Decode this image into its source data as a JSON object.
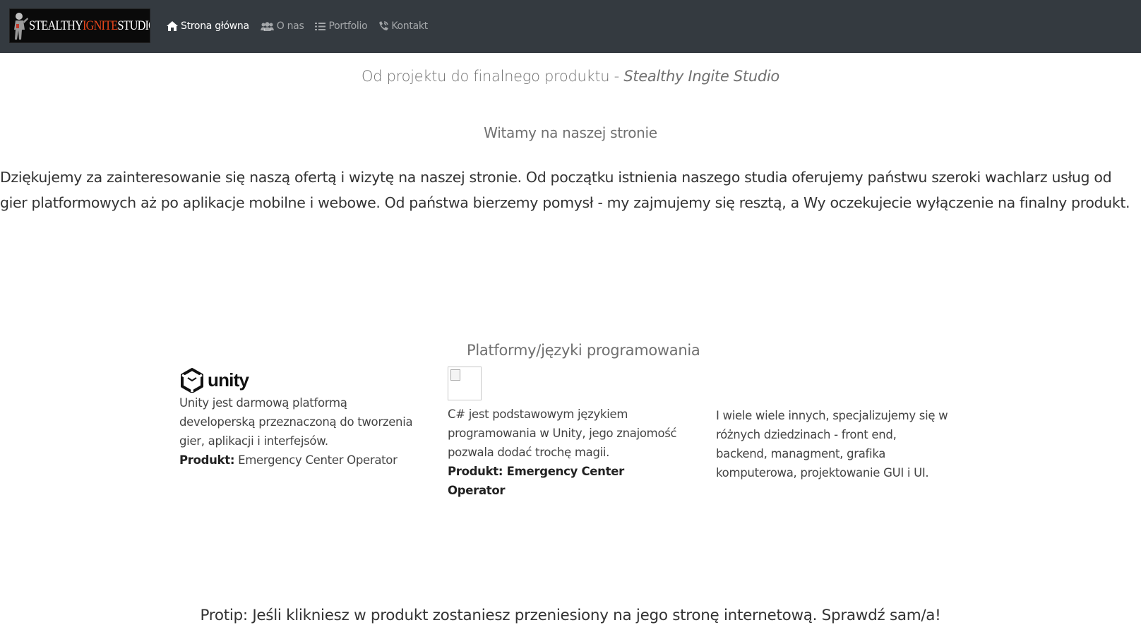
{
  "brand": {
    "logo_part1": "STEALTHY",
    "logo_part2": "IGNITE",
    "logo_part3": "STUDIO",
    "colors": {
      "navbar": "#343a40",
      "ignite_accent": "#e8461b"
    }
  },
  "nav": {
    "items": [
      {
        "label": "Strona główna",
        "icon": "home-icon",
        "active": true
      },
      {
        "label": "O nas",
        "icon": "users-icon",
        "active": false
      },
      {
        "label": "Portfolio",
        "icon": "list-icon",
        "active": false
      },
      {
        "label": "Kontakt",
        "icon": "phone-icon",
        "active": false
      }
    ]
  },
  "hero": {
    "tagline_prefix": "Od projektu do finalnego produktu - ",
    "tagline_brand": "Stealthy Ingite Studio",
    "welcome": "Witamy na naszej stronie",
    "intro": "Dziękujemy za zainteresowanie się naszą ofertą i wizytę na naszej stronie. Od początku istnienia naszego studia oferujemy państwu szeroki wachlarz usług od gier platformowych aż po aplikacje mobilne i webowe. Od państwa bierzemy pomysł - my zajmujemy się resztą, a Wy oczekujecie wyłączenie na finalny produkt."
  },
  "platforms": {
    "heading": "Platformy/języki programowania",
    "unity": {
      "logo_text": "unity",
      "description": "Unity jest darmową platformą developerską przeznaczoną do tworzenia gier, aplikacji i interfejsów.",
      "product_label": "Produkt:",
      "product_name": "Emergency Center Operator"
    },
    "csharp": {
      "description": "C# jest podstawowym językiem programowania w Unity, jego znajomość pozwala dodać trochę magii.",
      "product_label": "Produkt:",
      "product_name": "Emergency Center Operator"
    },
    "others": {
      "description": "I wiele wiele innych, specjalizujemy się w różnych dziedzinach - front end, backend, managment, grafika komputerowa, projektowanie GUI i UI."
    }
  },
  "protip": "Protip: Jeśli klikniesz w produkt zostaniesz przeniesiony na jego stronę internetową. Sprawdź sam/a!"
}
